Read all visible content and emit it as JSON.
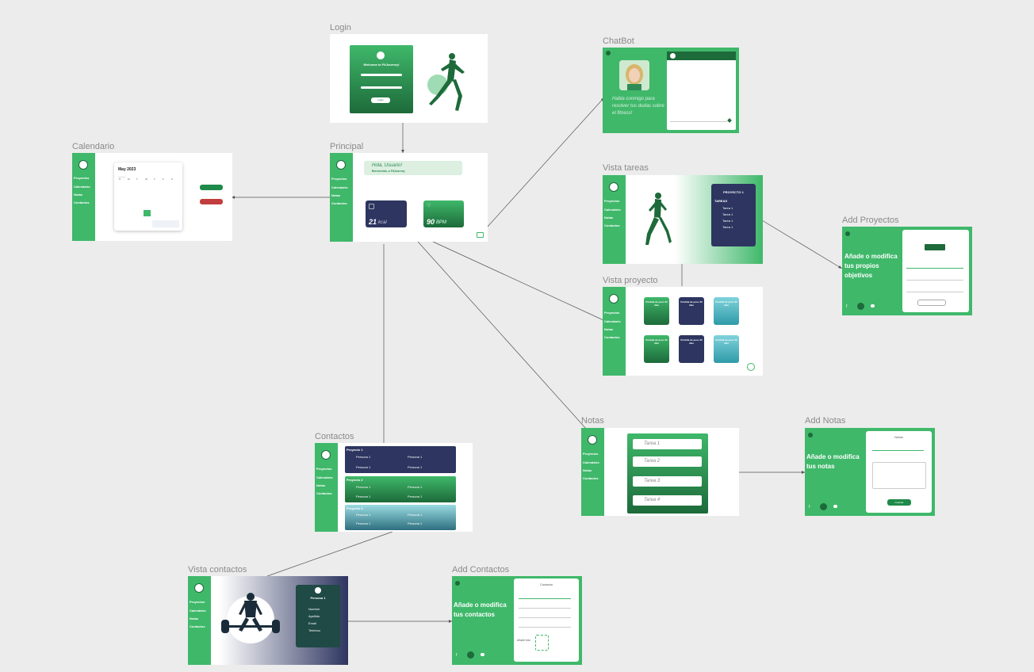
{
  "frames": {
    "login": "Login",
    "chatbot": "ChatBot",
    "calendario": "Calendario",
    "principal": "Principal",
    "vista_tareas": "Vista tareas",
    "add_proyectos": "Add Proyectos",
    "vista_proyecto": "Vista proyecto",
    "notas": "Notas",
    "add_notas": "Add Notas",
    "contactos": "Contactos",
    "vista_contactos": "Vista contactos",
    "add_contactos": "Add Contactos"
  },
  "nav": [
    "Proyectos",
    "Calendario",
    "Notas",
    "Contactos"
  ],
  "login": {
    "welcome": "Welcome to FitJourney!",
    "button": "Login"
  },
  "chatbot": {
    "text": "Habla conmigo para resolver tus dudas sobre el fitness!"
  },
  "calendario": {
    "month": "May 2023",
    "weekdays": [
      "Su",
      "Mo",
      "Tu",
      "We",
      "Th",
      "Fr",
      "Sa"
    ]
  },
  "principal": {
    "greeting": "Hola, Usuario!",
    "sub": "Bienvenido, a FitJourney",
    "kcal": "21",
    "kcal_unit": "kcal",
    "bpm": "90",
    "bpm_unit": "BPM"
  },
  "tareas": {
    "project": "PROYECTO 1",
    "label": "TAREAS",
    "items": [
      "Tarea 1",
      "Tarea 1",
      "Tarea 1",
      "Tarea 1"
    ]
  },
  "add_proyectos": {
    "heading": "Añade o modifica tus propios objetivos"
  },
  "proyecto": {
    "card": "Perdida de peso 30 días"
  },
  "notas": {
    "items": [
      "Tarea 1",
      "Tarea 2",
      "Tarea 3",
      "Tarea 4"
    ]
  },
  "add_notas": {
    "heading": "Añade o modifica tus notas",
    "title": "Notas",
    "button": "Guardar"
  },
  "contactos": {
    "groups": [
      {
        "title": "Proyecto 1",
        "people": [
          "Persona 1",
          "Persona 1",
          "Persona 1",
          "Persona 1"
        ]
      },
      {
        "title": "Proyecto 2",
        "people": [
          "Persona 1",
          "Persona 1",
          "Persona 1",
          "Persona 1"
        ]
      },
      {
        "title": "Proyecto 3",
        "people": [
          "Persona 1",
          "Persona 1",
          "Persona 1",
          "Persona 1"
        ]
      }
    ]
  },
  "vista_contactos": {
    "name": "Persona 1",
    "fields": [
      "Nombre",
      "Apellido",
      "Email",
      "Telefono"
    ]
  },
  "add_contactos": {
    "heading": "Añade o modifica tus contactos",
    "title": "Contacto",
    "photo": "Añadir foto"
  },
  "colors": {
    "brand": "#3fb86a",
    "dark_green": "#1d6a3a",
    "navy": "#2d3560",
    "canvas": "#ececec"
  }
}
